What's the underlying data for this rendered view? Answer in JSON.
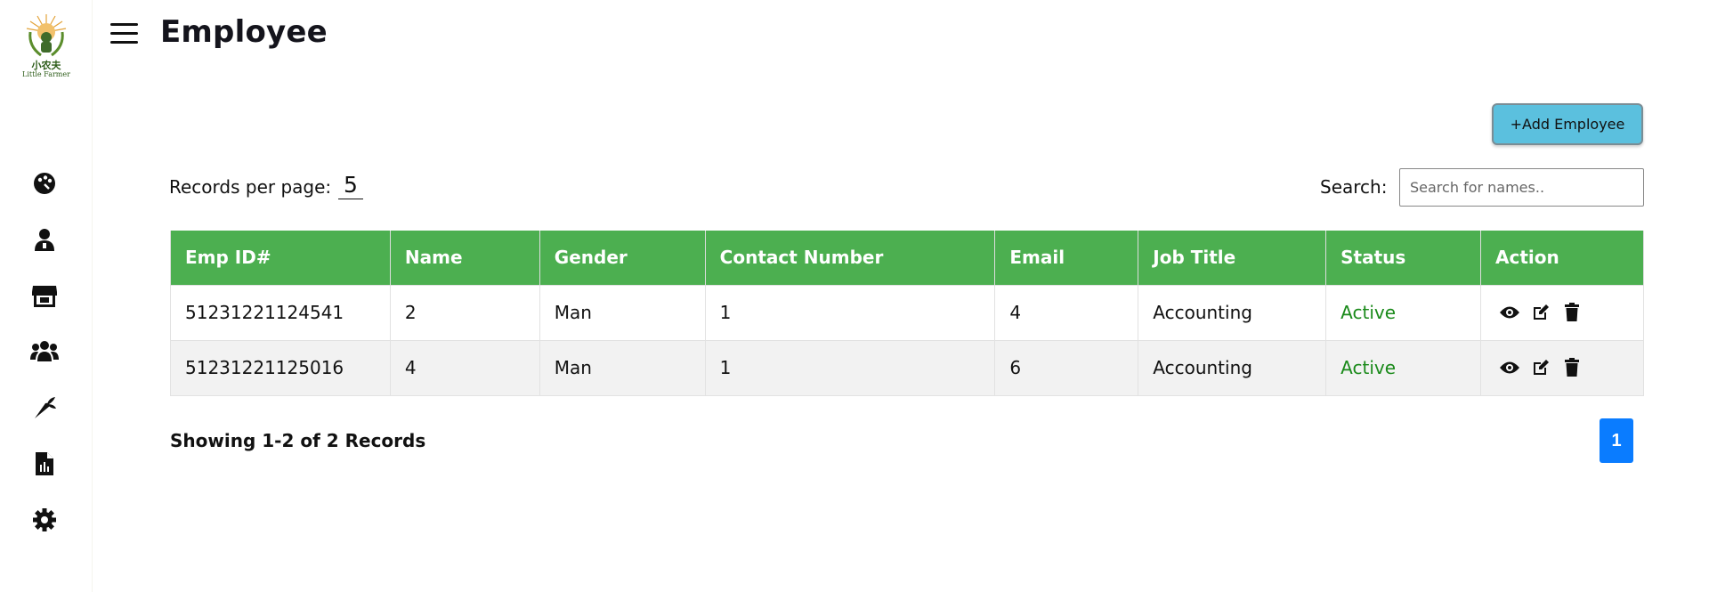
{
  "brand": {
    "name_cn": "小农夫",
    "name_en": "Little Farmer"
  },
  "header": {
    "title": "Employee"
  },
  "sidebar": {
    "items": [
      {
        "icon": "palette-icon",
        "label": "Dashboard"
      },
      {
        "icon": "user-icon",
        "label": "Users"
      },
      {
        "icon": "store-icon",
        "label": "Store"
      },
      {
        "icon": "users-group-icon",
        "label": "Employees"
      },
      {
        "icon": "carrot-icon",
        "label": "Products"
      },
      {
        "icon": "report-icon",
        "label": "Reports"
      },
      {
        "icon": "gear-icon",
        "label": "Settings"
      }
    ]
  },
  "toolbar": {
    "add_label": "+Add Employee"
  },
  "records": {
    "label": "Records per page:",
    "value": "5"
  },
  "search": {
    "label": "Search:",
    "placeholder": "Search for names.."
  },
  "table": {
    "headers": [
      "Emp ID#",
      "Name",
      "Gender",
      "Contact Number",
      "Email",
      "Job Title",
      "Status",
      "Action"
    ],
    "rows": [
      {
        "emp_id": "51231221124541",
        "name": "2",
        "gender": "Man",
        "contact": "1",
        "email": "4",
        "job_title": "Accounting",
        "status": "Active"
      },
      {
        "emp_id": "51231221125016",
        "name": "4",
        "gender": "Man",
        "contact": "1",
        "email": "6",
        "job_title": "Accounting",
        "status": "Active"
      }
    ]
  },
  "footer": {
    "showing": "Showing 1-2 of 2 Records",
    "current_page": "1"
  },
  "colors": {
    "header_green": "#4caf50",
    "status_green": "#1a8a1a",
    "add_button": "#5bc0de",
    "page_blue": "#0a7cff"
  }
}
